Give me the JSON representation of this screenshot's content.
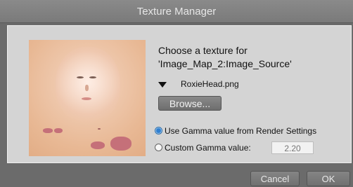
{
  "window": {
    "title": "Texture Manager"
  },
  "dialog": {
    "prompt_line1": "Choose a texture for",
    "prompt_line2": "'Image_Map_2:Image_Source'",
    "selected_file": "RoxieHead.png",
    "browse_label": "Browse...",
    "gamma_option_render": "Use Gamma value from Render Settings",
    "gamma_option_custom": "Custom Gamma value:",
    "custom_gamma_value": "2.20",
    "selected_gamma_option": "render_settings",
    "accent_color": "#2f7fd0"
  },
  "footer": {
    "cancel_label": "Cancel",
    "ok_label": "OK"
  },
  "icons": [
    "texture-preview-image",
    "dropdown-triangle-icon",
    "radio-selected-icon",
    "radio-unselected-icon"
  ]
}
